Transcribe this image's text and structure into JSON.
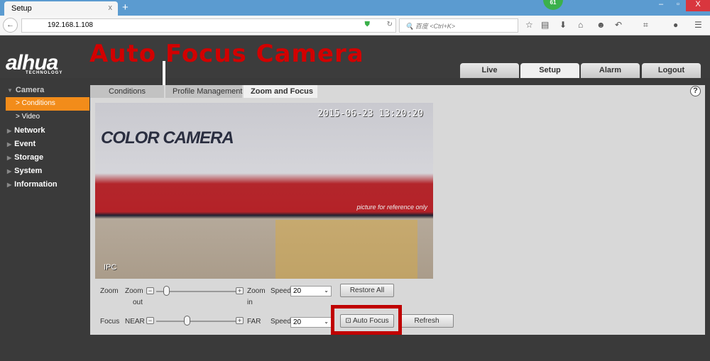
{
  "browser": {
    "tab_title": "Setup",
    "tab_close": "x",
    "new_tab": "+",
    "badge": "61",
    "url": "192.168.1.108",
    "search_placeholder": "百度 <Ctrl+K>",
    "min": "–",
    "max": "▫",
    "close": "X"
  },
  "annotation": {
    "title": "Auto Focus Camera",
    "highlight_color": "#c00000"
  },
  "logo": {
    "text": "alhua",
    "sub": "TECHNOLOGY"
  },
  "main_tabs": [
    {
      "label": "Live"
    },
    {
      "label": "Setup",
      "active": true
    },
    {
      "label": "Alarm"
    },
    {
      "label": "Logout"
    }
  ],
  "sidebar": {
    "items": [
      {
        "label": "Camera",
        "expanded": true
      },
      {
        "label": "Network"
      },
      {
        "label": "Event"
      },
      {
        "label": "Storage"
      },
      {
        "label": "System"
      },
      {
        "label": "Information"
      }
    ],
    "sub_items": [
      {
        "label": "Conditions",
        "active": true
      },
      {
        "label": "Video"
      }
    ]
  },
  "content_tabs": [
    {
      "label": "Conditions"
    },
    {
      "label": "Profile Management"
    },
    {
      "label": "Zoom and Focus",
      "active": true
    }
  ],
  "help": "?",
  "video": {
    "label": "COLOR CAMERA",
    "timestamp": "2015-06-23 13:20:20",
    "note": "picture for reference only",
    "channel": "IPC"
  },
  "zoom": {
    "label": "Zoom",
    "min_label_1": "Zoom",
    "min_label_2": "out",
    "max_label_1": "Zoom",
    "max_label_2": "in",
    "position_percent": 10,
    "speed_label": "Speed",
    "speed": "20",
    "button": "Restore All"
  },
  "focus": {
    "label": "Focus",
    "min_label": "NEAR",
    "max_label": "FAR",
    "position_percent": 38,
    "speed_label": "Speed",
    "speed": "20",
    "button_auto": "Auto Focus",
    "button_refresh": "Refresh"
  },
  "controls": {
    "minus": "−",
    "plus": "+",
    "chevron": "⌄"
  }
}
